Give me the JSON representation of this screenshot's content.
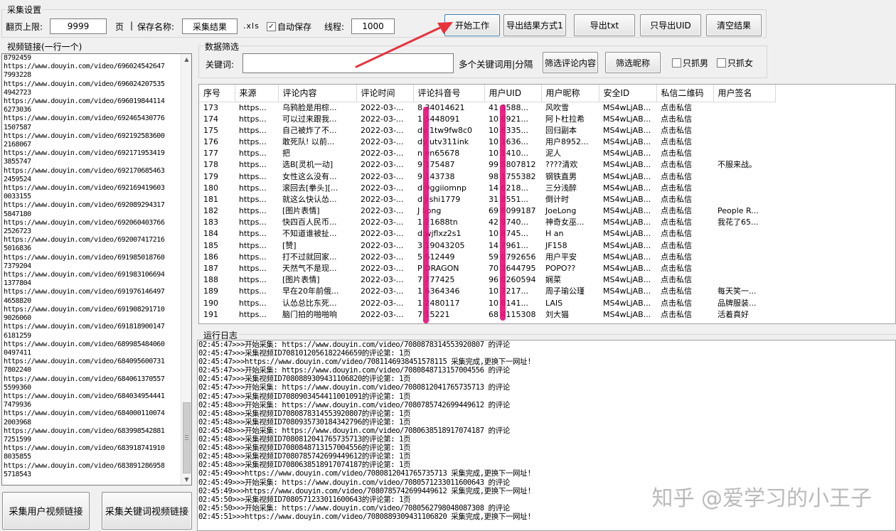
{
  "settings": {
    "group_title": "采集设置",
    "page_limit_label": "翻页上限:",
    "page_limit_value": "9999",
    "page_unit": "页",
    "save_name_label": "保存名称:",
    "save_name_value": "采集结果",
    "ext": ".xls",
    "auto_save_label": "自动保存",
    "auto_save_checked": true,
    "threads_label": "线程:",
    "threads_value": "1000"
  },
  "toolbar": {
    "start": "开始工作",
    "export_mode": "导出结果方式1",
    "export_txt": "导出txt",
    "export_uid": "只导出UID",
    "clear": "清空结果"
  },
  "filter": {
    "group_title": "数据筛选",
    "keyword_label": "关键词:",
    "keyword_value": "",
    "hint": "多个关键词用|分隔",
    "filter_comment": "筛选评论内容",
    "filter_nick": "筛选昵称",
    "male_only": "只抓男",
    "female_only": "只抓女"
  },
  "links": {
    "group_title": "视频链接(一行一个)",
    "text": "8792459\nhttps://www.douyin.com/video/696024542647\n7993228\nhttps://www.douyin.com/video/696024207535\n4942723\nhttps://www.douyin.com/video/696019844114\n6273036\nhttps://www.douyin.com/video/692465430776\n1507587\nhttps://www.douyin.com/video/692192583600\n2168067\nhttps://www.douyin.com/video/692171953419\n3855747\nhttps://www.douyin.com/video/692170685463\n2459524\nhttps://www.douyin.com/video/692169419603\n0033155\nhttps://www.douyin.com/video/692089294317\n5847180\nhttps://www.douyin.com/video/692060403766\n2526723\nhttps://www.douyin.com/video/692007417216\n5016836\nhttps://www.douyin.com/video/691985018760\n7379204\nhttps://www.douyin.com/video/691983106694\n1377804\nhttps://www.douyin.com/video/691976146497\n4658820\nhttps://www.douyin.com/video/691908291710\n9026060\nhttps://www.douyin.com/video/691818900147\n6181259\nhttps://www.douyin.com/video/689985484060\n0497411\nhttps://www.douyin.com/video/684095600731\n7802240\nhttps://www.douyin.com/video/684061370557\n5599360\nhttps://www.douyin.com/video/684034954441\n7479936\nhttps://www.douyin.com/video/684000110074\n2003968\nhttps://www.douyin.com/video/683998542881\n7251599\nhttps://www.douyin.com/video/683918741910\n8035855\nhttps://www.douyin.com/video/683891286958\n5718543"
  },
  "bottom_buttons": {
    "user_links": "采集用户视频链接",
    "keyword_links": "采集关键词视频链接"
  },
  "table": {
    "columns": [
      "序号",
      "来源",
      "评论内容",
      "评论时间",
      "评论抖音号",
      "用户UID",
      "用户昵称",
      "安全ID",
      "私信二维码",
      "用户签名"
    ],
    "rows": [
      [
        "173",
        "https...",
        "乌鸦脸是用棕...",
        "2022-03-...",
        "8  34014621",
        "41  3588...",
        "风吹雪",
        "MS4wLjAB...",
        "点击私信",
        ""
      ],
      [
        "174",
        "https...",
        "可以过来跟我...",
        "2022-03-...",
        "1  5448091",
        "10  6921...",
        "阿卜杜拉希",
        "MS4wLjAB...",
        "点击私信",
        ""
      ],
      [
        "175",
        "https...",
        "自己被炸了不...",
        "2022-03-...",
        "dy  1tw9fw8c0",
        "10  6335...",
        "回归副本",
        "MS4wLjAB...",
        "点击私信",
        ""
      ],
      [
        "176",
        "https...",
        "敢死队! 以前...",
        "2022-03-...",
        "dy  utv311ink",
        "10  1636...",
        "用户8952...",
        "MS4wLjAB...",
        "点击私信",
        ""
      ],
      [
        "177",
        "https...",
        "把",
        "2022-03-...",
        "n  en65678",
        "10  1410...",
        "泥人",
        "MS4wLjAB...",
        "点击私信",
        ""
      ],
      [
        "178",
        "https...",
        "选B[灵机一动]",
        "2022-03-...",
        "9  175487",
        "99  5807812",
        "????清欢",
        "MS4wLjAB...",
        "点击私信",
        "不服来战。"
      ],
      [
        "179",
        "https...",
        "女性这么没有...",
        "2022-03-...",
        "9  143738",
        "98  1755382",
        "钢铁直男",
        "MS4wLjAB...",
        "点击私信",
        ""
      ],
      [
        "180",
        "https...",
        "滚回去[拳头][...",
        "2022-03-...",
        "d  9ggiiomnp",
        "14  6218...",
        "三分浅醉",
        "MS4wLjAB...",
        "点击私信",
        ""
      ],
      [
        "181",
        "https...",
        "就这么快认怂...",
        "2022-03-...",
        "d  jishi1779",
        "31  8551...",
        "倒计时",
        "MS4wLjAB...",
        "点击私信",
        ""
      ],
      [
        "182",
        "https...",
        "[图片表情]",
        "2022-03-...",
        "J  Long",
        "69  6099187",
        "JoeLong",
        "MS4wLjAB...",
        "点击私信",
        "People R..."
      ],
      [
        "183",
        "https...",
        "快四百人民币...",
        "2022-03-...",
        "1  21688tn",
        "42  9740...",
        "神奇女巫...",
        "MS4wLjAB...",
        "点击私信",
        "我花了65..."
      ],
      [
        "184",
        "https...",
        "不知道谁被扯...",
        "2022-03-...",
        "d  wjflxz2s1",
        "10  8745...",
        "H an",
        "MS4wLjAB...",
        "点击私信",
        ""
      ],
      [
        "185",
        "https...",
        "[赞]",
        "2022-03-...",
        "3  19043205",
        "14  7961...",
        "JF158",
        "MS4wLjAB...",
        "点击私信",
        ""
      ],
      [
        "186",
        "https...",
        "打不过就回家...",
        "2022-03-...",
        "5  612449",
        "59  0792656",
        "用户平安",
        "MS4wLjAB...",
        "点击私信",
        ""
      ],
      [
        "187",
        "https...",
        "天然气不是现...",
        "2022-03-...",
        "P  DRAGON",
        "70  3644795",
        "POPO??",
        "MS4wLjAB...",
        "点击私信",
        ""
      ],
      [
        "188",
        "https...",
        "[图片表情]",
        "2022-03-...",
        "7  777425",
        "96  0260594",
        "娴菜",
        "MS4wLjAB...",
        "点击私信",
        ""
      ],
      [
        "189",
        "https...",
        "早在20年前俄...",
        "2022-03-...",
        "1  6364346",
        "10  7217...",
        "周子瑜公瑾",
        "MS4wLjAB...",
        "点击私信",
        "每天笑一..."
      ],
      [
        "190",
        "https...",
        "认怂总比东死...",
        "2022-03-...",
        "1  2480117",
        "10  6141...",
        "LAIS",
        "MS4wLjAB...",
        "点击私信",
        "品牌服装..."
      ],
      [
        "191",
        "https...",
        "脑门拍的啪啪响",
        "2022-03-...",
        "7  15221",
        "68  4115308",
        "刘大猫",
        "MS4wLjAB...",
        "点击私信",
        "活着真好"
      ]
    ]
  },
  "log": {
    "group_title": "运行日志",
    "text": "02:45:47>>>开始采集: https://www.douyin.com/video/7080878314553920807 的评论\n02:45:47>>>采集视频ID7081012056182246659的评论第: 1页\n02:45:47>>>https://www.douyin.com/video/7081146938451578115 采集完成,更换下一网址!\n02:45:47>>>开始采集: https://www.douyin.com/video/7080848713157004556 的评论\n02:45:47>>>采集视频ID7080889309431106820的评论第: 1页\n02:45:47>>>开始采集: https://www.douyin.com/video/7080812041765735713 的评论\n02:45:47>>>采集视频ID7080903454411001091的评论第: 1页\n02:45:48>>>开始采集: https://www.douyin.com/video/7080785742699449612 的评论\n02:45:48>>>采集视频ID7080878314553920807的评论第: 1页\n02:45:48>>>采集视频ID7080935730184342796的评论第: 1页\n02:45:48>>>开始采集: https://www.douyin.com/video/7080638518917074187 的评论\n02:45:48>>>采集视频ID7080812041765735713的评论第: 1页\n02:45:48>>>采集视频ID7080848713157004556的评论第: 1页\n02:45:48>>>采集视频ID7080785742699449612的评论第: 1页\n02:45:48>>>采集视频ID7080638518917074187的评论第: 1页\n02:45:49>>>https://www.douyin.com/video/7080812041765735713 采集完成,更换下一网址!\n02:45:49>>>开始采集: https://www.douyin.com/video/7080571233011600643 的评论\n02:45:49>>>https://www.douyin.com/video/7080785742699449612 采集完成,更换下一网址!\n02:45:50>>>采集视频ID7080571233011600643的评论第: 1页\n02:45:50>>>开始采集: https://www.douyin.com/video/7080562798048087308 的评论\n02:45:51>>>https://www.douyin.com/video/7080889309431106820 采集完成,更换下一网址!"
  },
  "watermark": "知乎 @爱学习的小王子",
  "colors": {
    "annotation_arrow": "#e8323c",
    "redaction_marker": "#e8107a"
  }
}
